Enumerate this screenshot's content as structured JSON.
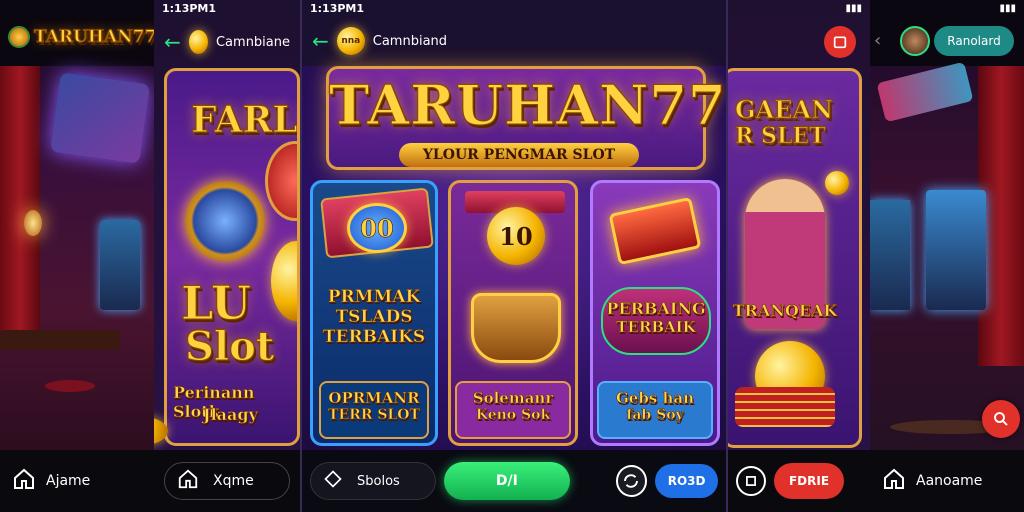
{
  "colors": {
    "accent_green": "#20e070",
    "accent_blue": "#1f6fe6",
    "accent_red": "#e0322a",
    "teal": "#1e8a86",
    "gold": "#ffd23f",
    "purple_bg": "#2a1050"
  },
  "icons": {
    "home": "home-icon",
    "back": "arrow-left-icon",
    "refresh": "refresh-icon",
    "calendar": "calendar-icon",
    "support": "support-icon"
  },
  "panel1": {
    "brand": "TARUHAN77",
    "nav_label": "Ajame"
  },
  "panel2": {
    "status_time": "1:13PM1",
    "topbar_title": "Camnbiane",
    "banner_title": "FARLI",
    "slot_big": "LU",
    "slot_word": "Slot",
    "caption_line1": "Perinann Slotk",
    "caption_line2": "Jlaagy",
    "nav_label": "Xqme"
  },
  "main": {
    "status_time": "1:13PM1",
    "topbar_title": "Camnbiand",
    "badge_text": "nna",
    "hero_title": "TARUHAN77",
    "hero_subtitle": "YLOUR PENGMAR SLOT",
    "cards": [
      {
        "badge": "00",
        "title_lines": [
          "PRMMAK",
          "TSLADS",
          "TERBAIKS"
        ],
        "footer_lines": [
          "OPRMANR",
          "TERR SLOT"
        ]
      },
      {
        "badge": "10",
        "title_lines": [],
        "footer_lines": [
          "Solemanr",
          "Keno Sok"
        ]
      },
      {
        "badge": "",
        "title_lines": [
          "PERBAING",
          "TERBAIK"
        ],
        "footer_lines": [
          "Gebs han",
          "fab Soy"
        ]
      }
    ],
    "bottom_search": "Sbolos",
    "bottom_main_button": "D/I",
    "bottom_right_button": "RO3D"
  },
  "panel4": {
    "banner_title_line1": "GAEAN",
    "banner_title_line2": "R SLET",
    "card_label": "TRANQEAK",
    "bottom_button": "FDRIE"
  },
  "panel5": {
    "top_button": "Ranolard",
    "nav_label": "Aanoame"
  }
}
